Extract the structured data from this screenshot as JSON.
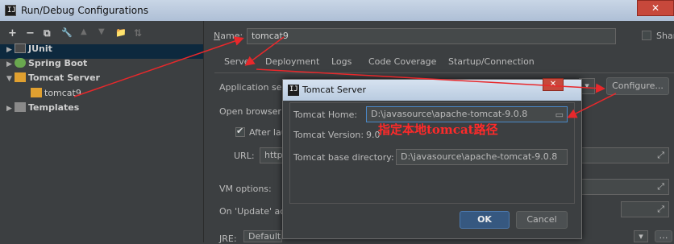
{
  "window": {
    "title": "Run/Debug Configurations",
    "close_glyph": "✕"
  },
  "toolbar": {
    "add": "+",
    "remove": "−",
    "copy": "⧉",
    "wrench": "🔧",
    "up": "▲",
    "down": "▼",
    "folder": "📁",
    "sort": "⇅"
  },
  "tree": {
    "junit": "JUnit",
    "spring_boot": "Spring Boot",
    "tomcat_server": "Tomcat Server",
    "tomcat9": "tomcat9",
    "templates": "Templates"
  },
  "config": {
    "name_label_prefix": "N",
    "name_label_rest": "ame:",
    "name_value": "tomcat9",
    "share_label": "Shar",
    "tabs": [
      "Server",
      "Deployment",
      "Logs",
      "Code Coverage",
      "Startup/Connection"
    ],
    "app_server_label": "Application ser",
    "configure_button": "Configure...",
    "open_browser_label": "Open browser",
    "after_launch_label": "After lau",
    "url_label": "URL:",
    "url_value": "http:",
    "vm_options_label": "VM options:",
    "on_update_label": "On 'Update' act",
    "jre_label": "JRE:",
    "jre_value": "Default"
  },
  "dialog": {
    "title": "Tomcat Server",
    "home_label": "Tomcat Home:",
    "home_value": "D:\\javasource\\apache-tomcat-9.0.8",
    "version_label": "Tomcat Version:",
    "version_value": "9.0",
    "base_label": "Tomcat base directory:",
    "base_value": "D:\\javasource\\apache-tomcat-9.0.8",
    "ok": "OK",
    "cancel": "Cancel",
    "close_glyph": "✕"
  },
  "annotation": {
    "text": "指定本地tomcat路径",
    "color": "#ff2a2a"
  },
  "colors": {
    "background": "#3c3f41",
    "selection": "#0d293e",
    "accent_arrow": "#e8282b"
  }
}
